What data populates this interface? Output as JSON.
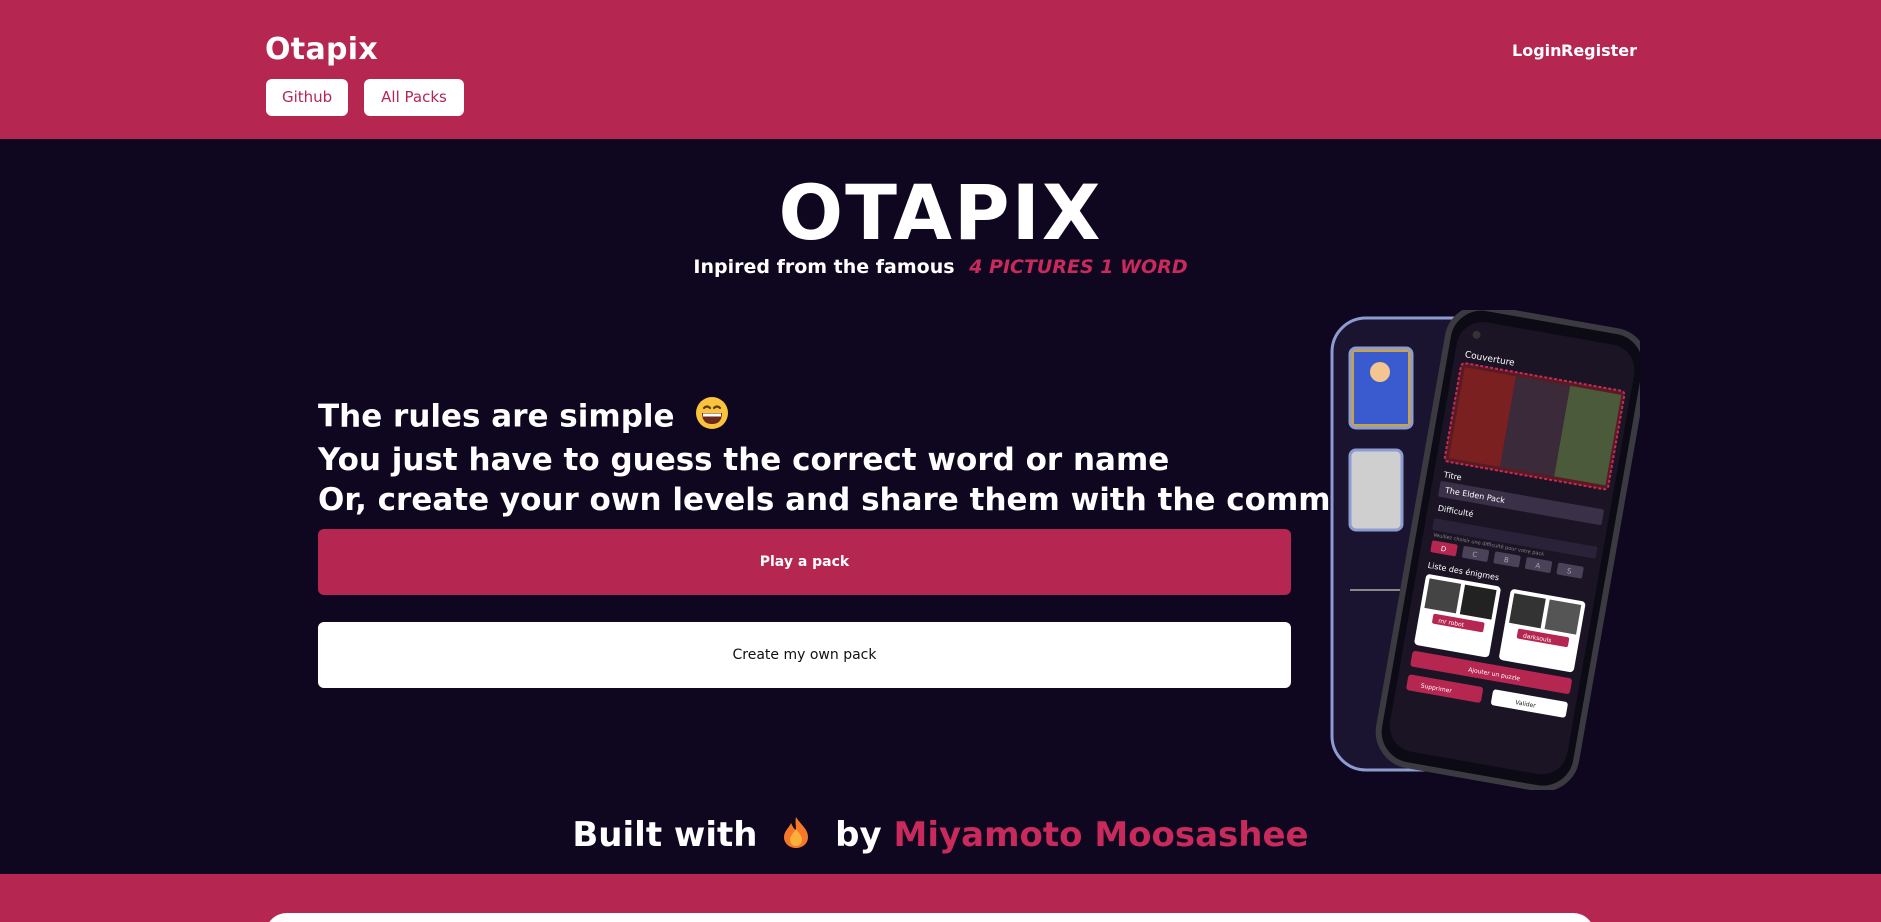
{
  "header": {
    "brand": "Otapix",
    "nav": {
      "github": "Github",
      "all_packs": "All Packs"
    },
    "auth": {
      "login": "Login",
      "register": "Register"
    }
  },
  "hero": {
    "title": "OTAPIX",
    "tagline_prefix": "Inpired from the famous",
    "tagline_accent": "4 PICTURES 1 WORD"
  },
  "rules": {
    "line1": "The rules are simple",
    "line1_emoji": "grinning-face-emoji",
    "line2": "You just have to guess the correct word or name",
    "line3": "Or, create your own levels and share them with the community"
  },
  "actions": {
    "play": "Play a pack",
    "create": "Create my own pack"
  },
  "preview": {
    "section_cover": "Couverture",
    "label_title": "Titre",
    "value_title": "The Elden Pack",
    "label_difficulty": "Difficulté",
    "difficulty_hint": "Veuillez choisir une difficulté pour votre pack",
    "difficulties": [
      "D",
      "C",
      "B",
      "A",
      "S"
    ],
    "section_puzzles": "Liste des énigmes",
    "puzzle_answers": [
      "mr robot",
      "darksouls"
    ],
    "add_puzzle": "Ajouter un puzzle",
    "delete": "Supprimer",
    "validate": "Valider"
  },
  "footer": {
    "built_with": "Built with",
    "emoji": "fire-emoji",
    "by": "by",
    "author": "Miyamoto Moosashee"
  },
  "colors": {
    "brand": "#b52651",
    "background": "#0f0620",
    "accent_text": "#c72a5b"
  }
}
